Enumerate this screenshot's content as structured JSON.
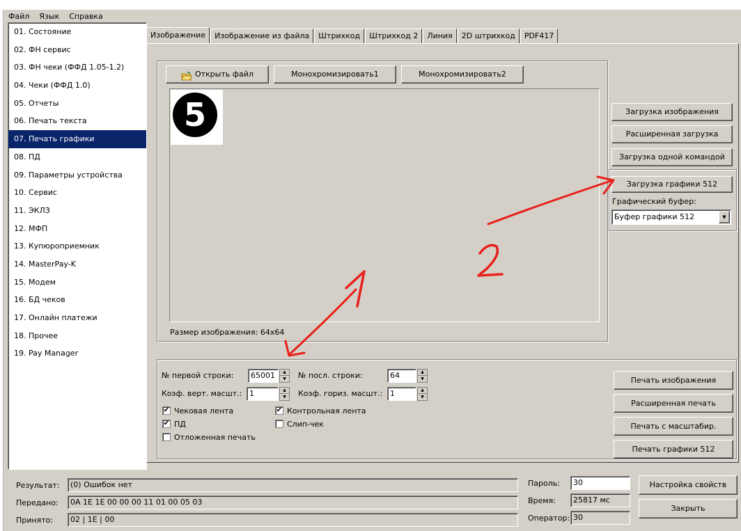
{
  "menu": [
    "Файл",
    "Язык",
    "Справка"
  ],
  "nav": {
    "items": [
      "01. Состояние",
      "02. ФН сервис",
      "03. ФН чеки (ФФД 1.05-1.2)",
      "04. Чеки (ФФД 1.0)",
      "05. Отчеты",
      "06. Печать текста",
      "07. Печать графики",
      "08. ПД",
      "09. Параметры устройства",
      "10. Сервис",
      "11. ЭКЛЗ",
      "12. МФП",
      "13. Купюроприемник",
      "14. MasterPay-K",
      "15. Модем",
      "16. БД чеков",
      "17. Онлайн платежи",
      "18. Прочее",
      "19. Pay Manager"
    ],
    "selected_index": 6
  },
  "tabs": [
    "Изображение",
    "Изображение из файла",
    "Штрихкод",
    "Штрихкод 2",
    "Линия",
    "2D штрихкод",
    "PDF417"
  ],
  "toolbar": {
    "open_file": "Открыть файл",
    "mono1": "Монохромизировать1",
    "mono2": "Монохромизировать2"
  },
  "preview": {
    "glyph": "5",
    "size_label": "Размер изображения: 64x64"
  },
  "load_buttons": {
    "load_image": "Загрузка изображения",
    "extended_load": "Расширенная загрузка",
    "single_command": "Загрузка одной командой",
    "load_512": "Загрузка графики 512",
    "buffer_label": "Графический буфер:",
    "buffer_value": "Буфер графики 512"
  },
  "annotations": {
    "one": "1",
    "two": "2",
    "color": "#e8201a"
  },
  "print": {
    "first_line_label": "№ первой строки:",
    "first_line_value": "65001",
    "last_line_label": "№ посл. строки:",
    "last_line_value": "64",
    "vscale_label": "Коэф. верт. масшт.:",
    "vscale_value": "1",
    "hscale_label": "Коэф. гориз. масшт.:",
    "hscale_value": "1",
    "chk_receipt": "Чековая лента",
    "chk_control": "Контрольная лента",
    "chk_pd": "ПД",
    "chk_slip": "Слип-чек",
    "chk_deferred": "Отложенная печать",
    "btn_print": "Печать изображения",
    "btn_ext_print": "Расширенная печать",
    "btn_scaled": "Печать с масштабир.",
    "btn_print512": "Печать графики 512"
  },
  "status": {
    "result_label": "Результат:",
    "result_value": "(0) Ошибок нет",
    "sent_label": "Передано:",
    "sent_value": "0A 1E 1E 00 00 00 11 01 00 05 03",
    "recv_label": "Принято:",
    "recv_value": "02 | 1E | 00",
    "password_label": "Пароль:",
    "password_value": "30",
    "time_label": "Время:",
    "time_value": "25817 мс",
    "operator_label": "Оператор:",
    "operator_value": "30",
    "settings_button": "Настройка свойств",
    "close_button": "Закрыть"
  }
}
